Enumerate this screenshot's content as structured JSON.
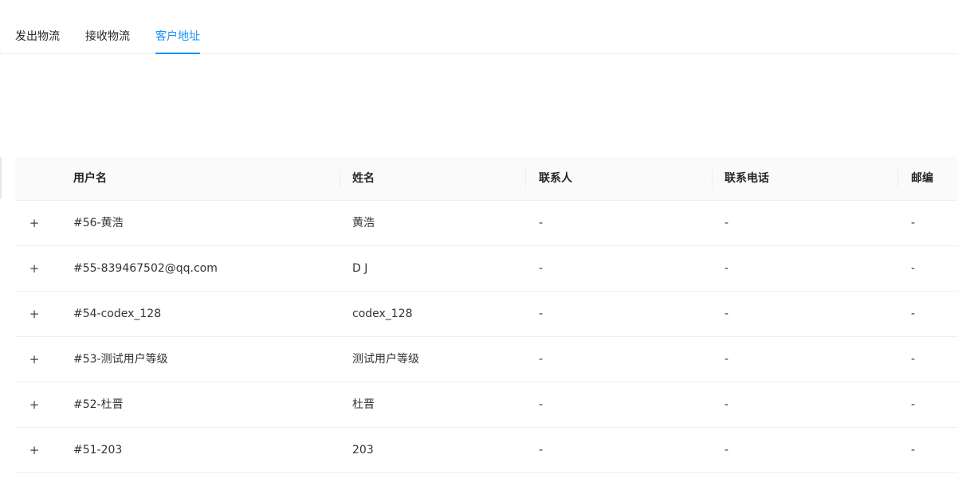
{
  "tabs": [
    {
      "label": "发出物流",
      "active": false
    },
    {
      "label": "接收物流",
      "active": false
    },
    {
      "label": "客户地址",
      "active": true
    }
  ],
  "accent_color": "#1890ff",
  "table": {
    "columns": [
      "用户名",
      "姓名",
      "联系人",
      "联系电话",
      "邮编"
    ],
    "expand_icon": "+",
    "rows": [
      {
        "user": "#56-黄浩",
        "name": "黄浩",
        "contact": "-",
        "phone": "-",
        "zip": "-"
      },
      {
        "user": "#55-839467502@qq.com",
        "name": "D J",
        "contact": "-",
        "phone": "-",
        "zip": "-"
      },
      {
        "user": "#54-codex_128",
        "name": "codex_128",
        "contact": "-",
        "phone": "-",
        "zip": "-"
      },
      {
        "user": "#53-测试用户等级",
        "name": "测试用户等级",
        "contact": "-",
        "phone": "-",
        "zip": "-"
      },
      {
        "user": "#52-杜晋",
        "name": "杜晋",
        "contact": "-",
        "phone": "-",
        "zip": "-"
      },
      {
        "user": "#51-203",
        "name": "203",
        "contact": "-",
        "phone": "-",
        "zip": "-"
      }
    ]
  }
}
